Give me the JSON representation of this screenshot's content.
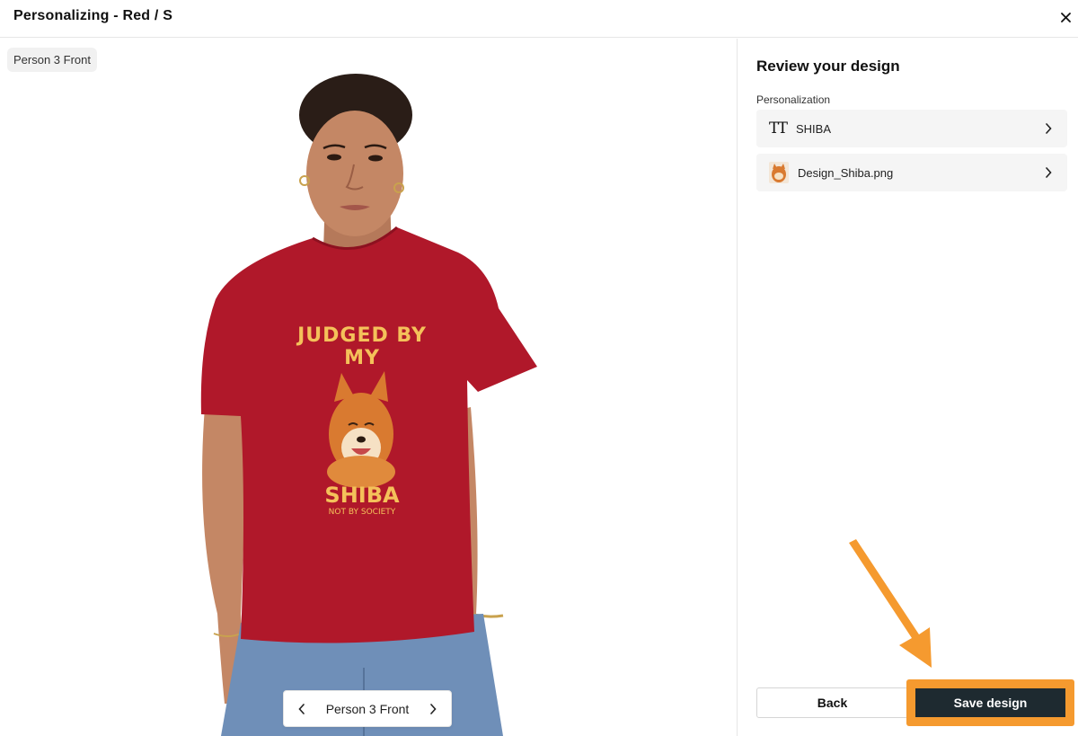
{
  "header": {
    "title": "Personalizing - Red / S",
    "close_icon": "close-icon"
  },
  "preview": {
    "view_tag": "Person 3 Front",
    "switcher_label": "Person 3 Front",
    "shirt_color": "#b0182a",
    "print": {
      "headline": "JUDGED BY MY",
      "big_word": "SHIBA",
      "tagline": "NOT BY SOCIETY",
      "text_color": "#f4c15a"
    }
  },
  "panel": {
    "title": "Review your design",
    "section_label": "Personalization",
    "items": [
      {
        "icon": "text-type-icon",
        "icon_glyph": "TT",
        "label": "SHIBA"
      },
      {
        "icon": "image-thumbnail",
        "label": "Design_Shiba.png"
      }
    ],
    "back_label": "Back",
    "save_label": "Save design",
    "accent": "#f59a2f",
    "save_bg": "#1e2a30"
  }
}
